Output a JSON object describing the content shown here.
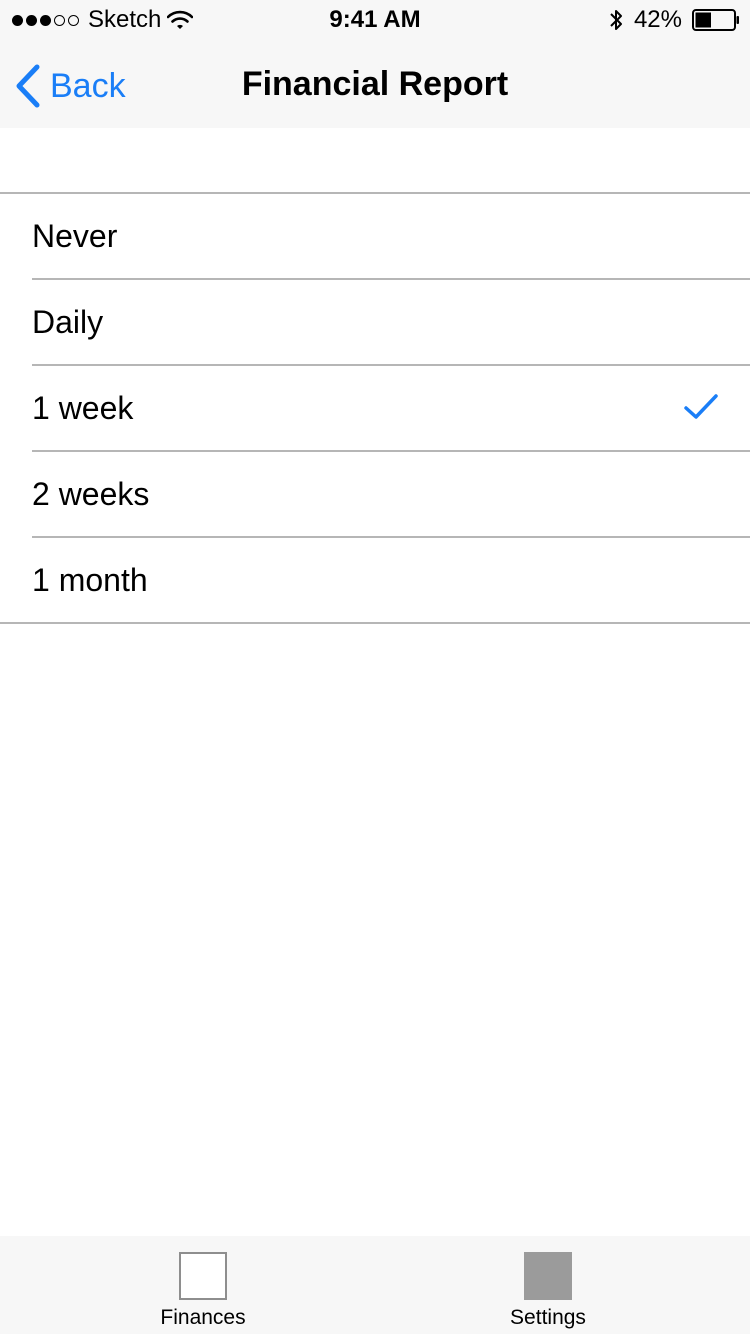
{
  "status_bar": {
    "carrier": "Sketch",
    "time": "9:41 AM",
    "battery_percent": "42%",
    "battery_level": 0.42,
    "signal_strength": 3,
    "signal_max": 5
  },
  "nav": {
    "back_label": "Back",
    "title": "Financial Report"
  },
  "options": [
    {
      "label": "Never",
      "selected": false
    },
    {
      "label": "Daily",
      "selected": false
    },
    {
      "label": "1 week",
      "selected": true
    },
    {
      "label": "2 weeks",
      "selected": false
    },
    {
      "label": "1 month",
      "selected": false
    }
  ],
  "tab_bar": {
    "tabs": [
      {
        "label": "Finances",
        "icon": "finances-icon",
        "active": false
      },
      {
        "label": "Settings",
        "icon": "settings-icon",
        "active": true
      }
    ]
  },
  "colors": {
    "accent": "#1a7ef7",
    "separator": "#b6b6b6",
    "bar_background": "#f7f7f7"
  }
}
